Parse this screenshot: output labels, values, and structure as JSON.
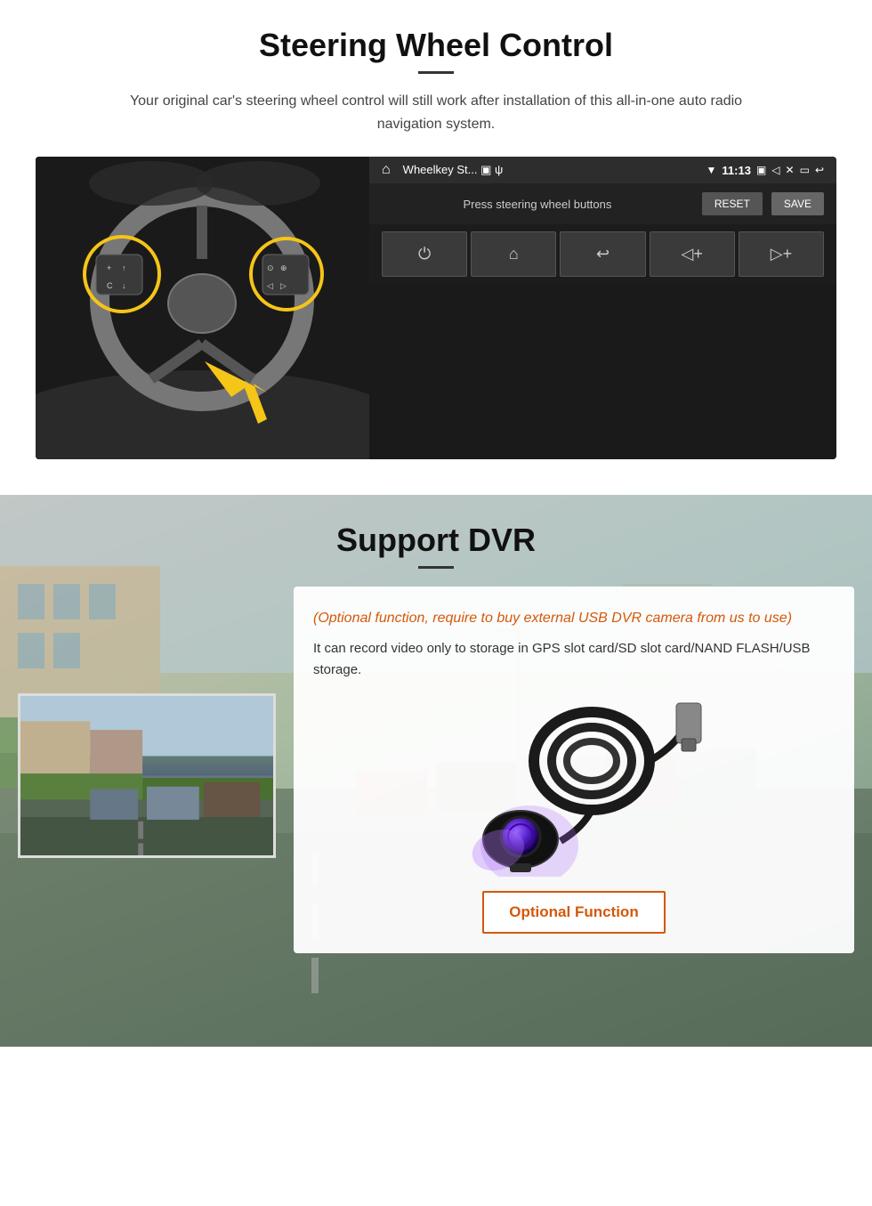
{
  "steering": {
    "title": "Steering Wheel Control",
    "subtitle": "Your original car's steering wheel control will still work after installation of this all-in-one auto radio navigation system.",
    "statusbar": {
      "home_icon": "⌂",
      "app_title": "Wheelkey St... ▣ ψ",
      "wifi_icon": "▼",
      "time": "11:13",
      "camera_icon": "▣",
      "sound_icon": "◁",
      "close_icon": "✕",
      "window_icon": "▭",
      "back_icon": "↩"
    },
    "swc": {
      "label": "Press steering wheel buttons",
      "reset_label": "RESET",
      "save_label": "SAVE"
    },
    "buttons": [
      {
        "icon": "⏻",
        "label": "power"
      },
      {
        "icon": "⌂",
        "label": "home"
      },
      {
        "icon": "↩",
        "label": "back"
      },
      {
        "icon": "◁+",
        "label": "vol-down"
      },
      {
        "icon": "▷+",
        "label": "vol-up"
      }
    ]
  },
  "dvr": {
    "title": "Support DVR",
    "optional_notice": "(Optional function, require to buy external USB DVR camera from us to use)",
    "description": "It can record video only to storage in GPS slot card/SD slot card/NAND FLASH/USB storage.",
    "optional_function_label": "Optional Function"
  }
}
